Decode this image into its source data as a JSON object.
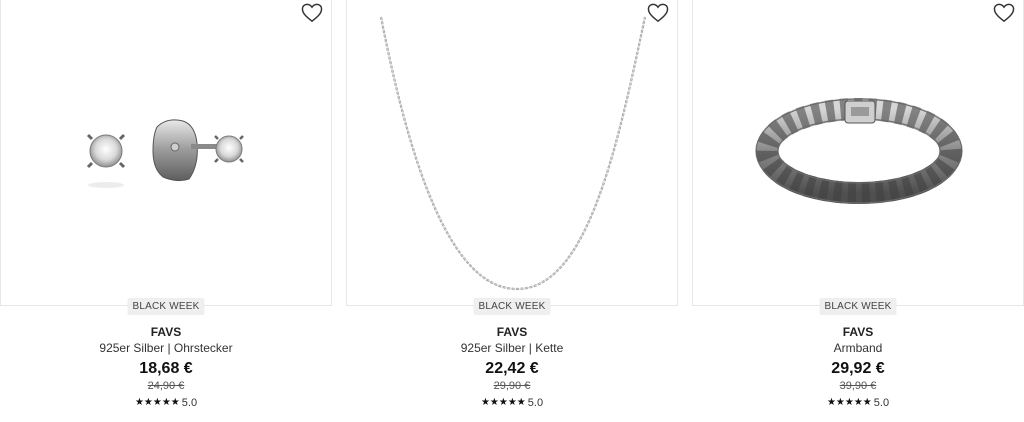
{
  "products": [
    {
      "badge": "BLACK WEEK",
      "brand": "FAVS",
      "name": "925er Silber | Ohrstecker",
      "price": "18,68 €",
      "old_price": "24,90 €",
      "stars": "★★★★★",
      "rating": "5.0",
      "image_icon": "stud-earrings-image"
    },
    {
      "badge": "BLACK WEEK",
      "brand": "FAVS",
      "name": "925er Silber | Kette",
      "price": "22,42 €",
      "old_price": "29,90 €",
      "stars": "★★★★★",
      "rating": "5.0",
      "image_icon": "necklace-image"
    },
    {
      "badge": "BLACK WEEK",
      "brand": "FAVS",
      "name": "Armband",
      "price": "29,92 €",
      "old_price": "39,90 €",
      "stars": "★★★★★",
      "rating": "5.0",
      "image_icon": "bracelet-image"
    }
  ]
}
